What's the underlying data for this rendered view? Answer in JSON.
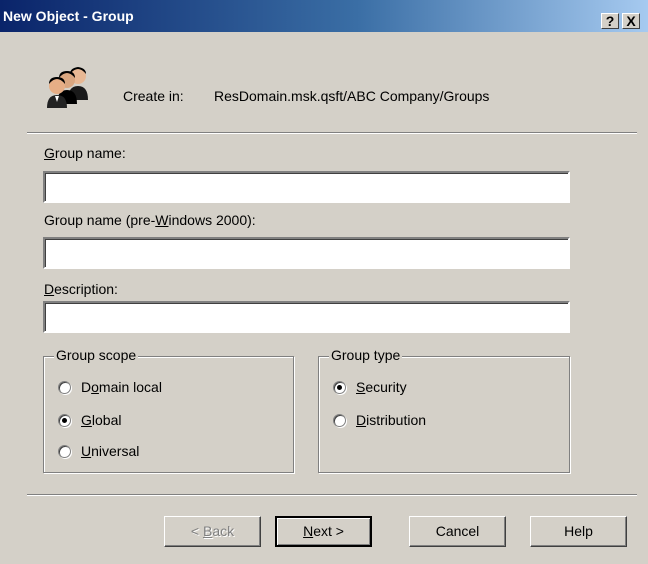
{
  "window": {
    "title": "New Object - Group",
    "help_btn": "?",
    "close_btn": "X"
  },
  "create_in": {
    "label": "Create in:",
    "path": "ResDomain.msk.qsft/ABC Company/Groups"
  },
  "fields": {
    "group_name": {
      "label_u": "G",
      "label_rest": "roup name:",
      "value": ""
    },
    "group_name_pre2000": {
      "label_pre": "Group name (pre-",
      "label_u": "W",
      "label_rest": "indows 2000):",
      "value": ""
    },
    "description": {
      "label_pre": "",
      "label_u": "D",
      "label_rest": "escription:",
      "value": ""
    }
  },
  "group_scope": {
    "legend": "Group scope",
    "options": [
      {
        "pre": "D",
        "u": "o",
        "rest": "main local",
        "checked": false
      },
      {
        "pre": "",
        "u": "G",
        "rest": "lobal",
        "checked": true
      },
      {
        "pre": "",
        "u": "U",
        "rest": "niversal",
        "checked": false
      }
    ]
  },
  "group_type": {
    "legend": "Group type",
    "options": [
      {
        "pre": "",
        "u": "S",
        "rest": "ecurity",
        "checked": true
      },
      {
        "pre": "",
        "u": "D",
        "rest": "istribution",
        "checked": false
      }
    ]
  },
  "buttons": {
    "back": {
      "pre": "< ",
      "u": "B",
      "rest": "ack"
    },
    "next": {
      "pre": "",
      "u": "N",
      "rest": "ext >"
    },
    "cancel": "Cancel",
    "help": "Help"
  }
}
